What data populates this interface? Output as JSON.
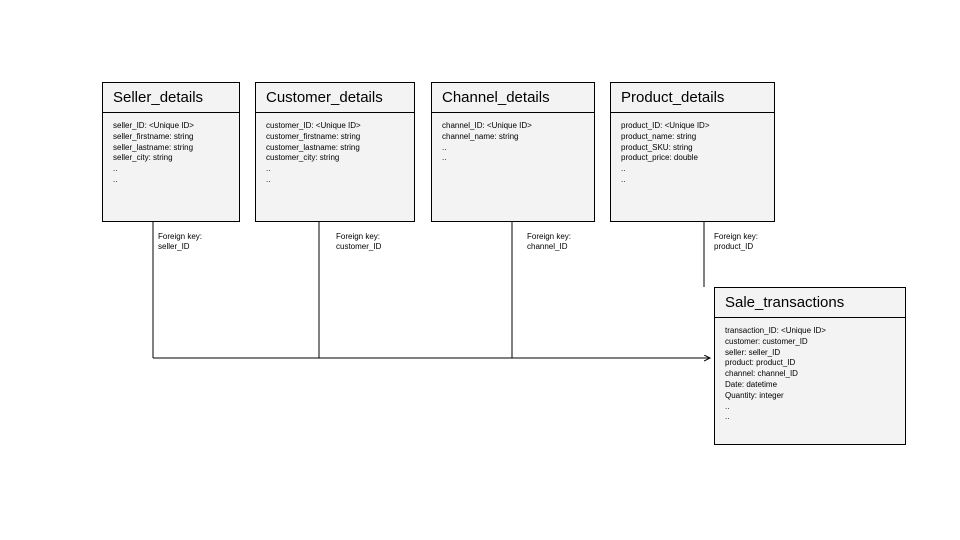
{
  "entities": {
    "seller": {
      "title": "Seller_details",
      "fields": [
        "seller_ID: <Unique ID>",
        "seller_firstname: string",
        "seller_lastname: string",
        "seller_city: string",
        "..",
        ".."
      ],
      "fk_label": "Foreign key:",
      "fk_key": "seller_ID"
    },
    "customer": {
      "title": "Customer_details",
      "fields": [
        "customer_ID: <Unique ID>",
        "customer_firstname: string",
        "customer_lastname: string",
        "customer_city: string",
        "..",
        ".."
      ],
      "fk_label": "Foreign key:",
      "fk_key": "customer_ID"
    },
    "channel": {
      "title": "Channel_details",
      "fields": [
        "channel_ID: <Unique ID>",
        "channel_name: string",
        "..",
        ".."
      ],
      "fk_label": "Foreign key:",
      "fk_key": "channel_ID"
    },
    "product": {
      "title": "Product_details",
      "fields": [
        "product_ID: <Unique ID>",
        "product_name: string",
        "product_SKU: string",
        "product_price: double",
        "..",
        ".."
      ],
      "fk_label": "Foreign key:",
      "fk_key": "product_ID"
    },
    "sale": {
      "title": "Sale_transactions",
      "fields": [
        "transaction_ID: <Unique ID>",
        "customer: customer_ID",
        "seller: seller_ID",
        "product: product_ID",
        "channel: channel_ID",
        "Date: datetime",
        "Quantity: integer",
        "..",
        ".."
      ]
    }
  }
}
